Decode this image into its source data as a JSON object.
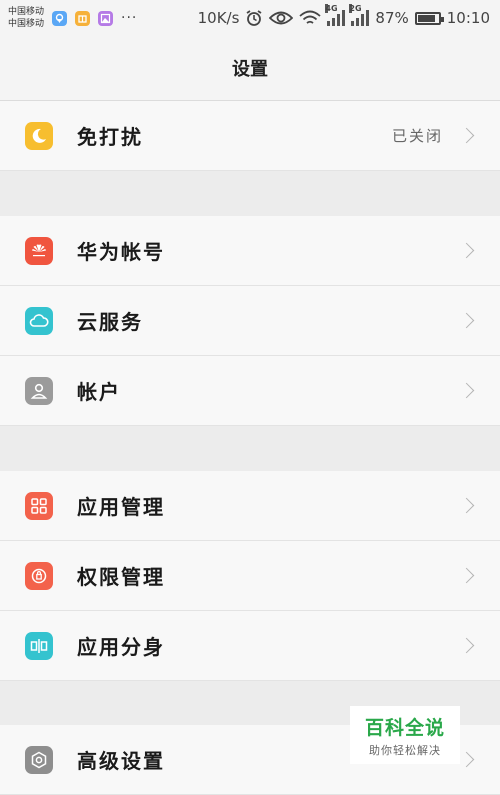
{
  "status_bar": {
    "carrier_1": "中国移动",
    "carrier_2": "中国移动",
    "more": "···",
    "speed": "10K/s",
    "net_4g": "4G",
    "net_2g": "2G",
    "battery_percent": "87%",
    "battery_level": 0.87,
    "time": "10:10",
    "icons": [
      "location-app-icon",
      "gift-app-icon",
      "gallery-app-icon",
      "alarm-icon",
      "eye-icon",
      "wifi-icon",
      "signal-icon",
      "battery-icon"
    ]
  },
  "title": "设置",
  "items": [
    {
      "label": "免打扰",
      "value": "已关闭",
      "icon": "moon-icon",
      "color": "#f7be2f"
    },
    {
      "label": "华为帐号",
      "value": "",
      "icon": "huawei-logo-icon",
      "color": "#f0553f"
    },
    {
      "label": "云服务",
      "value": "",
      "icon": "cloud-icon",
      "color": "#34c3cf"
    },
    {
      "label": "帐户",
      "value": "",
      "icon": "user-icon",
      "color": "#9b9b9b"
    },
    {
      "label": "应用管理",
      "value": "",
      "icon": "grid-icon",
      "color": "#f3624b"
    },
    {
      "label": "权限管理",
      "value": "",
      "icon": "lock-icon",
      "color": "#f3624b"
    },
    {
      "label": "应用分身",
      "value": "",
      "icon": "twin-app-icon",
      "color": "#34c3cf"
    },
    {
      "label": "高级设置",
      "value": "",
      "icon": "gear-icon",
      "color": "#8e8e8e"
    }
  ],
  "watermark": {
    "title": "百科全说",
    "subtitle": "助你轻松解决"
  }
}
